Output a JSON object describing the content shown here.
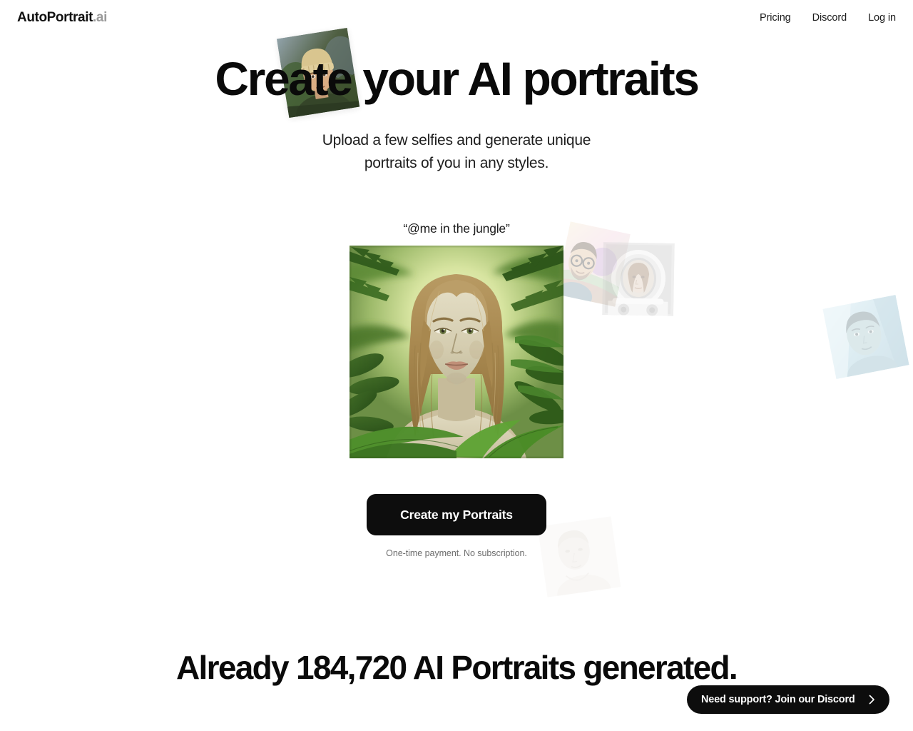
{
  "header": {
    "logo_main": "AutoPortrait",
    "logo_suffix": ".ai",
    "nav": [
      {
        "label": "Pricing"
      },
      {
        "label": "Discord"
      },
      {
        "label": "Log in"
      }
    ]
  },
  "hero": {
    "title": "Create your AI portraits",
    "subtitle_line1": "Upload a few selfies and generate unique",
    "subtitle_line2": "portraits of you in any styles.",
    "prompt_caption": "“@me in the jungle”",
    "main_image_alt": "AI portrait of a woman with long light-brown hair in a sunlit jungle of green ferns"
  },
  "cta": {
    "button_label": "Create my Portraits",
    "note": "One-time payment. No subscription.",
    "button_color": "#0d0d0d",
    "button_text_color": "#ffffff"
  },
  "stats": {
    "headline": "Already 184,720 AI Portraits generated.",
    "count": "184,720"
  },
  "support": {
    "label": "Need support? Join our Discord",
    "icon": "chevron-right-icon",
    "background_color": "#0d0d0d"
  },
  "floating_cards": [
    {
      "id": "card-beanie",
      "alt": "Portrait of a person wearing a tan knit beanie against dark green foliage"
    },
    {
      "id": "card-glasses",
      "alt": "Faded portrait of a person with glasses on a colorful pastel background"
    },
    {
      "id": "card-astronaut",
      "alt": "Faded grayscale portrait of a woman in an astronaut helmet"
    },
    {
      "id": "card-blue",
      "alt": "Faded blue-toned tilted portrait of a person"
    },
    {
      "id": "card-pale",
      "alt": "Very faded pale portrait of a person looking down"
    }
  ],
  "theme": {
    "background": "#ffffff",
    "text_primary": "#0a0a0a",
    "text_muted": "#6d6d6d",
    "accent_dark": "#0d0d0d"
  }
}
